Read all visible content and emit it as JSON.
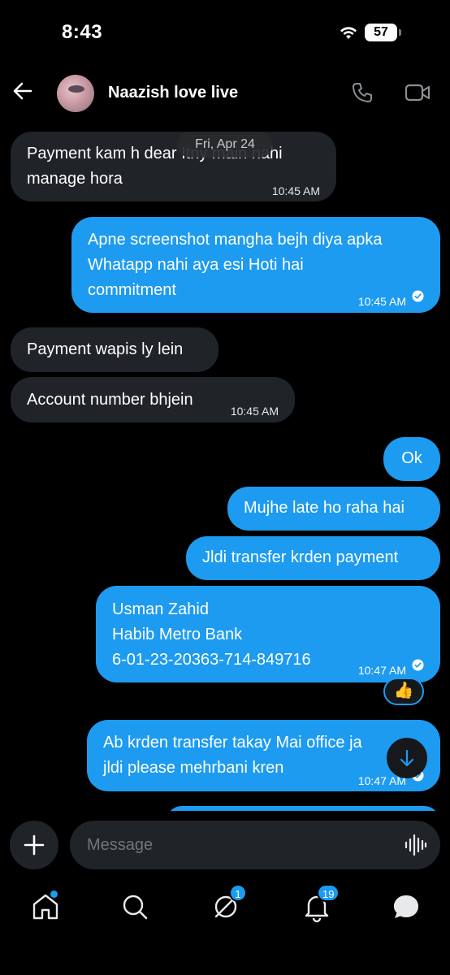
{
  "status": {
    "time": "8:43",
    "battery": "57"
  },
  "header": {
    "contact_name": "Naazish love live"
  },
  "date_separator": "Fri, Apr 24",
  "messages": [
    {
      "dir": "in",
      "text": "Payment kam h dear Itny main nahi\nmanage hora",
      "time": "10:45 AM"
    },
    {
      "dir": "out",
      "text": "Apne screenshot mangha bejh diya apka\nWhatapp nahi aya esi Hoti hai\ncommitment",
      "time": "10:45 AM"
    },
    {
      "dir": "in",
      "text": "Payment wapis ly lein",
      "time": ""
    },
    {
      "dir": "in",
      "text": "Account number bhjein",
      "time": "10:45 AM"
    },
    {
      "dir": "out",
      "text": "Ok",
      "time": ""
    },
    {
      "dir": "out",
      "text": "Mujhe late ho raha hai",
      "time": ""
    },
    {
      "dir": "out",
      "text": "Jldi transfer krden payment",
      "time": ""
    },
    {
      "dir": "out",
      "text": "Usman Zahid\nHabib Metro Bank\n6-01-23-20363-714-849716",
      "time": "10:47 AM"
    },
    {
      "dir": "out",
      "text": "Ab krden transfer takay Mai office ja\njldi please mehrbani kren",
      "time": "10:47 AM"
    }
  ],
  "reaction": "👍",
  "composer": {
    "placeholder": "Message"
  },
  "nav": {
    "messages_badge": "1",
    "notifications_badge": "19"
  },
  "colors": {
    "accent": "#1d9bf0",
    "incoming_bubble": "#202327",
    "background": "#000000"
  }
}
